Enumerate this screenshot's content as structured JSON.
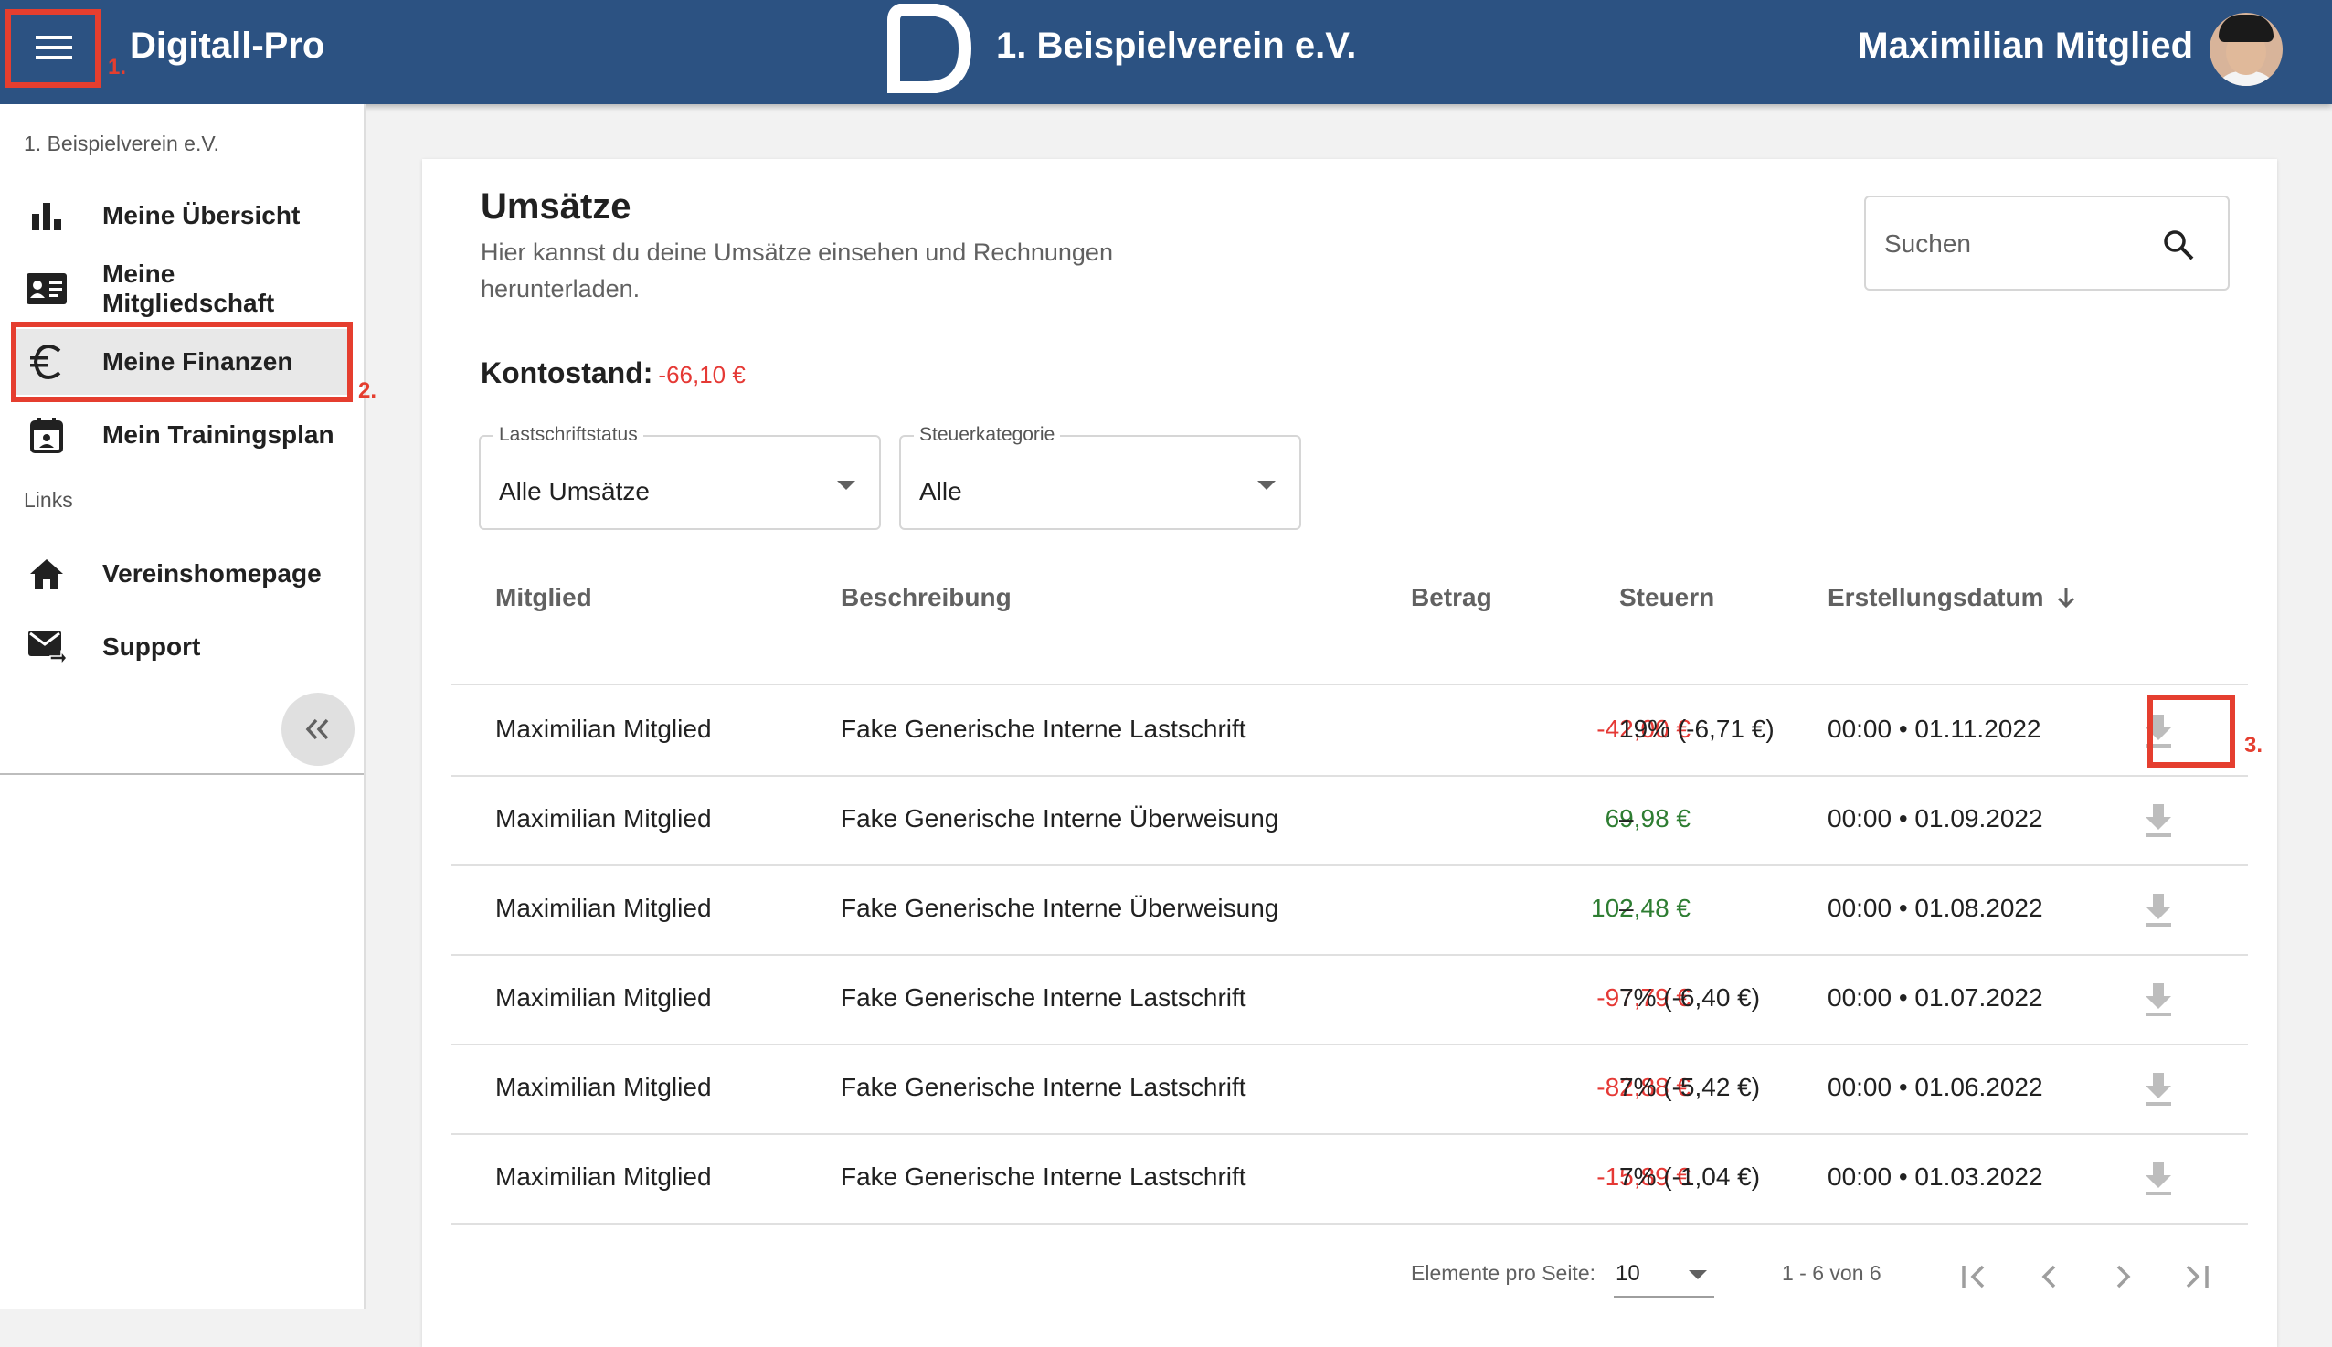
{
  "header": {
    "app_title": "Digitall-Pro",
    "club_title": "1. Beispielverein e.V.",
    "user_name": "Maximilian Mitglied",
    "color": "#2c5282"
  },
  "annotations": {
    "one": "1.",
    "two": "2.",
    "three": "3.",
    "color": "#e53e2f"
  },
  "sidebar": {
    "org": "1. Beispielverein e.V.",
    "items": [
      {
        "label": "Meine Übersicht",
        "icon": "bar-chart-icon"
      },
      {
        "label": "Meine Mitgliedschaft",
        "icon": "id-card-icon"
      },
      {
        "label": "Meine Finanzen",
        "icon": "euro-icon",
        "active": true
      },
      {
        "label": "Mein Trainingsplan",
        "icon": "calendar-icon"
      }
    ],
    "links_title": "Links",
    "links": [
      {
        "label": "Vereinshomepage",
        "icon": "home-icon"
      },
      {
        "label": "Support",
        "icon": "mail-forward-icon"
      }
    ]
  },
  "main": {
    "title": "Umsätze",
    "description": "Hier kannst du deine Umsätze einsehen und Rechnungen herunterladen.",
    "search_placeholder": "Suchen",
    "balance_label": "Kontostand:",
    "balance_value": "-66,10 €",
    "filters": [
      {
        "label": "Lastschriftstatus",
        "value": "Alle Umsätze"
      },
      {
        "label": "Steuerkategorie",
        "value": "Alle"
      }
    ]
  },
  "table": {
    "columns": [
      "Mitglied",
      "Beschreibung",
      "Betrag",
      "Steuern",
      "Erstellungsdatum"
    ],
    "sort_icon": "arrow-down-icon",
    "rows": [
      {
        "member": "Maximilian Mitglied",
        "description": "Fake Generische Interne Lastschrift",
        "amount": "-42,00 €",
        "sign": "neg",
        "tax": "19% (-6,71 €)",
        "date": "00:00 • 01.11.2022"
      },
      {
        "member": "Maximilian Mitglied",
        "description": "Fake Generische Interne Überweisung",
        "amount": "69,98 €",
        "sign": "pos",
        "tax": "–",
        "date": "00:00 • 01.09.2022"
      },
      {
        "member": "Maximilian Mitglied",
        "description": "Fake Generische Interne Überweisung",
        "amount": "102,48 €",
        "sign": "pos",
        "tax": "–",
        "date": "00:00 • 01.08.2022"
      },
      {
        "member": "Maximilian Mitglied",
        "description": "Fake Generische Interne Lastschrift",
        "amount": "-97,79 €",
        "sign": "neg",
        "tax": "7% (-6,40 €)",
        "date": "00:00 • 01.07.2022"
      },
      {
        "member": "Maximilian Mitglied",
        "description": "Fake Generische Interne Lastschrift",
        "amount": "-82,88 €",
        "sign": "neg",
        "tax": "7% (-5,42 €)",
        "date": "00:00 • 01.06.2022"
      },
      {
        "member": "Maximilian Mitglied",
        "description": "Fake Generische Interne Lastschrift",
        "amount": "-15,89 €",
        "sign": "neg",
        "tax": "7% (-1,04 €)",
        "date": "00:00 • 01.03.2022"
      }
    ]
  },
  "pagination": {
    "per_page_label": "Elemente pro Seite:",
    "per_page_value": "10",
    "range": "1 - 6 von 6"
  }
}
